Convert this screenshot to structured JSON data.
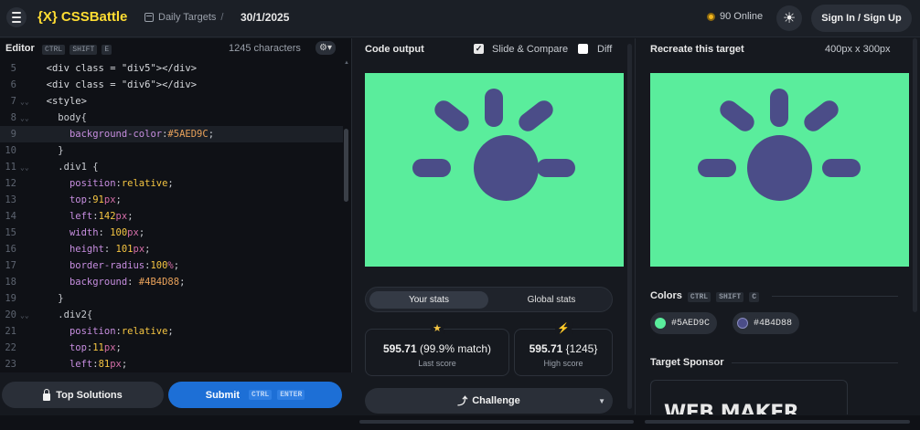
{
  "header": {
    "logo_mark": "{X}",
    "logo_name": "CSSBattle",
    "daily_targets_label": "Daily Targets",
    "date": "30/1/2025",
    "online_count": "90 Online",
    "signin_label": "Sign In / Sign Up"
  },
  "editor": {
    "title": "Editor",
    "shortcut": [
      "CTRL",
      "SHIFT",
      "E"
    ],
    "char_count": "1245 characters",
    "lines": [
      {
        "n": "5",
        "fold": "",
        "indent": "  ",
        "code": "<div class = \"div5\"></div>",
        "type": "html"
      },
      {
        "n": "6",
        "fold": "",
        "indent": "  ",
        "code": "<div class = \"div6\"></div>",
        "type": "html"
      },
      {
        "n": "7",
        "fold": "⌄⌄",
        "indent": "  ",
        "code": "<style>",
        "type": "html"
      },
      {
        "n": "8",
        "fold": "⌄⌄",
        "indent": "    ",
        "code": "body{",
        "type": "sel"
      },
      {
        "n": "9",
        "fold": "",
        "indent": "      ",
        "prop": "background-color",
        "val": "#5AED9C",
        "type": "decl",
        "hl": true
      },
      {
        "n": "10",
        "fold": "",
        "indent": "    ",
        "code": "}",
        "type": "sel"
      },
      {
        "n": "11",
        "fold": "⌄⌄",
        "indent": "    ",
        "code": ".div1 {",
        "type": "sel"
      },
      {
        "n": "12",
        "fold": "",
        "indent": "      ",
        "prop": "position",
        "val": "relative",
        "type": "decl"
      },
      {
        "n": "13",
        "fold": "",
        "indent": "      ",
        "prop": "top",
        "num": "91",
        "unit": "px",
        "type": "declnum"
      },
      {
        "n": "14",
        "fold": "",
        "indent": "      ",
        "prop": "left",
        "num": "142",
        "unit": "px",
        "type": "declnum"
      },
      {
        "n": "15",
        "fold": "",
        "indent": "      ",
        "prop": "width",
        "num": " 100",
        "unit": "px",
        "type": "declnum"
      },
      {
        "n": "16",
        "fold": "",
        "indent": "      ",
        "prop": "height",
        "num": " 101",
        "unit": "px",
        "type": "declnum"
      },
      {
        "n": "17",
        "fold": "",
        "indent": "      ",
        "prop": "border-radius",
        "num": "100",
        "unit": "%",
        "type": "declnum"
      },
      {
        "n": "18",
        "fold": "",
        "indent": "      ",
        "prop": "background",
        "val": " #4B4D88",
        "type": "decl"
      },
      {
        "n": "19",
        "fold": "",
        "indent": "    ",
        "code": "}",
        "type": "sel"
      },
      {
        "n": "20",
        "fold": "⌄⌄",
        "indent": "    ",
        "code": ".div2{",
        "type": "sel"
      },
      {
        "n": "21",
        "fold": "",
        "indent": "      ",
        "prop": "position",
        "val": "relative",
        "type": "decl"
      },
      {
        "n": "22",
        "fold": "",
        "indent": "      ",
        "prop": "top",
        "num": "11",
        "unit": "px",
        "type": "declnum"
      },
      {
        "n": "23",
        "fold": "",
        "indent": "      ",
        "prop": "left",
        "num": "81",
        "unit": "px",
        "type": "declnum"
      }
    ]
  },
  "buttons": {
    "top_solutions": "Top Solutions",
    "submit": "Submit",
    "submit_shortcut": [
      "CTRL",
      "ENTER"
    ]
  },
  "output": {
    "title": "Code output",
    "slide_compare": "Slide & Compare",
    "diff": "Diff",
    "slide_checked": true,
    "diff_checked": false,
    "stats_tabs": [
      "Your stats",
      "Global stats"
    ],
    "last_score_value": "595.71",
    "last_score_match": "(99.9% match)",
    "last_score_label": "Last score",
    "high_score_value": "595.71",
    "high_score_chars": "{1245}",
    "high_score_label": "High score",
    "challenge": "Challenge"
  },
  "target": {
    "title": "Recreate this target",
    "dims": "400px x 300px",
    "colors_label": "Colors",
    "colors_shortcut": [
      "CTRL",
      "SHIFT",
      "C"
    ],
    "colors": [
      "#5AED9C",
      "#4B4D88"
    ],
    "sponsor_label": "Target Sponsor",
    "sponsor_logo": "WEB MAKER"
  },
  "theme": {
    "bg": "#5AED9C",
    "shape": "#4B4D88",
    "accent_yellow": "#ffdd33",
    "submit_blue": "#1d6fd6"
  }
}
